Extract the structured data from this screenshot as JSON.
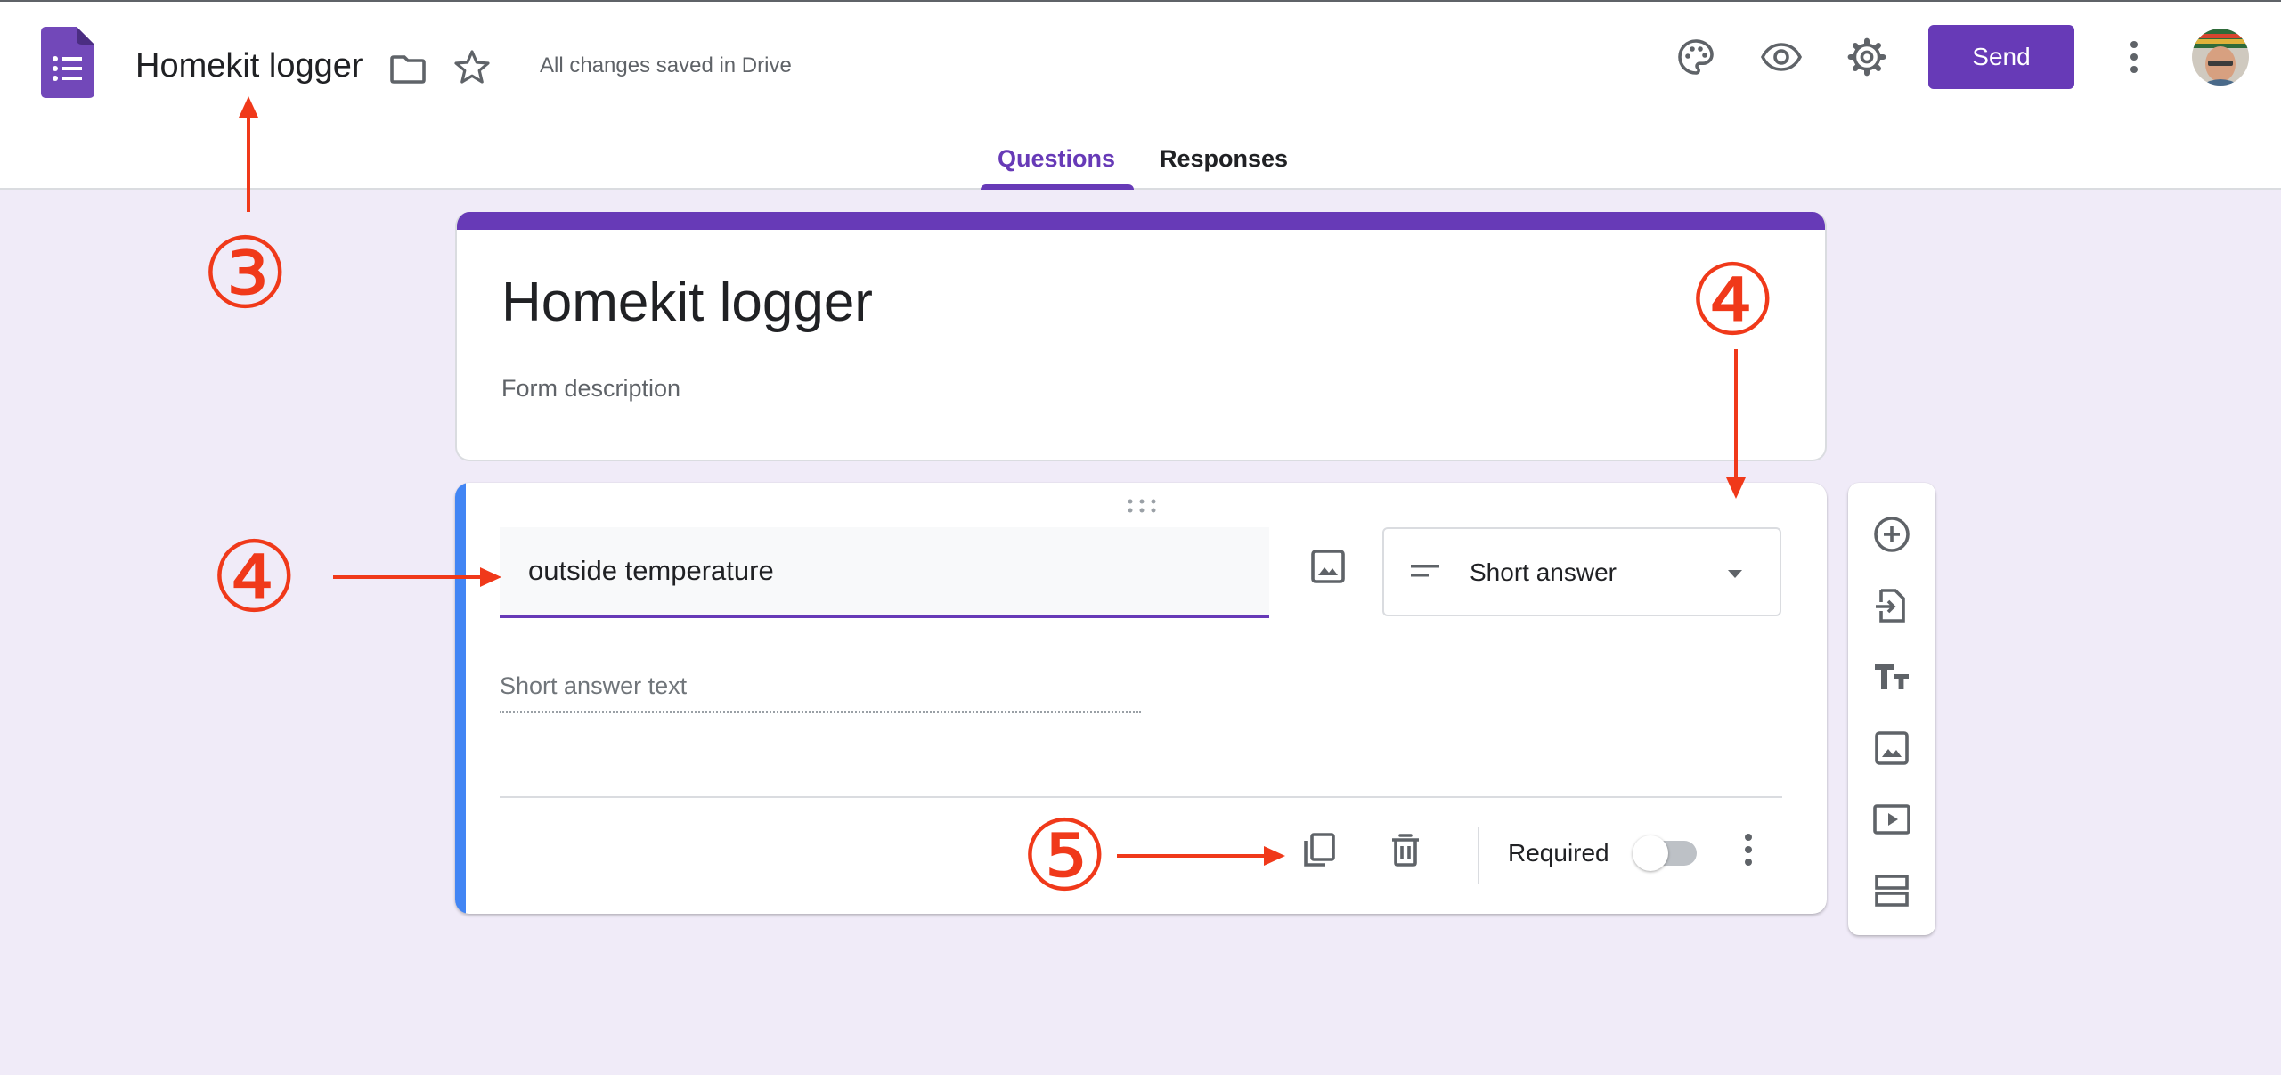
{
  "header": {
    "title": "Homekit logger",
    "save_status": "All changes saved in Drive",
    "send_label": "Send",
    "icons": [
      "forms-logo-icon",
      "folder-icon",
      "star-icon",
      "palette-icon",
      "eye-icon",
      "gear-icon",
      "more-vert-icon",
      "avatar"
    ]
  },
  "tabs": [
    {
      "label": "Questions",
      "active": true
    },
    {
      "label": "Responses",
      "active": false
    }
  ],
  "form": {
    "title": "Homekit logger",
    "description_placeholder": "Form description"
  },
  "question": {
    "title_value": "outside temperature",
    "type_label": "Short answer",
    "answer_placeholder": "Short answer text",
    "required_label": "Required",
    "required": false
  },
  "side_toolbar": {
    "icons": [
      "add-question-icon",
      "import-questions-icon",
      "add-title-icon",
      "add-image-icon",
      "add-video-icon",
      "add-section-icon"
    ]
  },
  "annotations": [
    "③",
    "④",
    "④",
    "⑤"
  ],
  "colors": {
    "accent": "#673ab7",
    "background": "#f0ebf8",
    "question_focus": "#4285f4",
    "annotation": "#f0391a"
  }
}
